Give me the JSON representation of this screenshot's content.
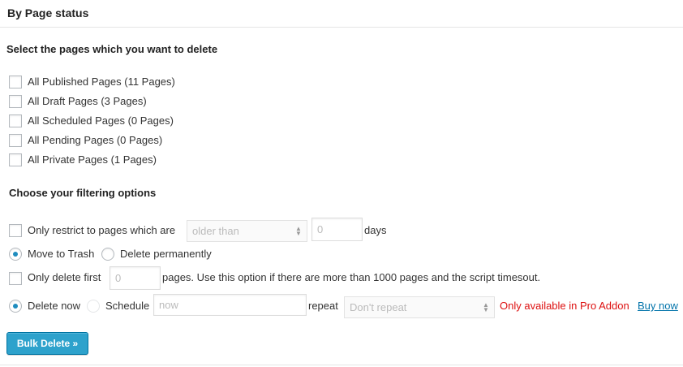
{
  "panel": {
    "title": "By Page status"
  },
  "pages_section": {
    "heading": "Select the pages which you want to delete",
    "options": [
      {
        "label": "All Published Pages (11 Pages)",
        "checked": false
      },
      {
        "label": "All Draft Pages (3 Pages)",
        "checked": false
      },
      {
        "label": "All Scheduled Pages (0 Pages)",
        "checked": false
      },
      {
        "label": "All Pending Pages (0 Pages)",
        "checked": false
      },
      {
        "label": "All Private Pages (1 Pages)",
        "checked": false
      }
    ]
  },
  "filter_section": {
    "heading": "Choose your filtering options",
    "restrict": {
      "label": "Only restrict to pages which are",
      "checked": false,
      "select_value": "older than",
      "days_value": "0",
      "days_unit": "days"
    },
    "delete_mode": {
      "trash_label": "Move to Trash",
      "permanent_label": "Delete permanently",
      "selected": "trash"
    },
    "limit": {
      "label": "Only delete first",
      "checked": false,
      "value": "0",
      "suffix": "pages. Use this option if there are more than 1000 pages and the script timesout."
    },
    "schedule": {
      "now_label": "Delete now",
      "schedule_label": "Schedule",
      "selected": "now",
      "time_placeholder": "now",
      "repeat_label": "repeat",
      "repeat_value": "Don't repeat",
      "pro_notice": "Only available in Pro Addon",
      "buy_link": "Buy now"
    }
  },
  "submit": {
    "label": "Bulk Delete »"
  },
  "colors": {
    "accent": "#2ea2cc",
    "link": "#0073aa",
    "error": "#dd1111",
    "radio_dot": "#1e8cbe"
  }
}
